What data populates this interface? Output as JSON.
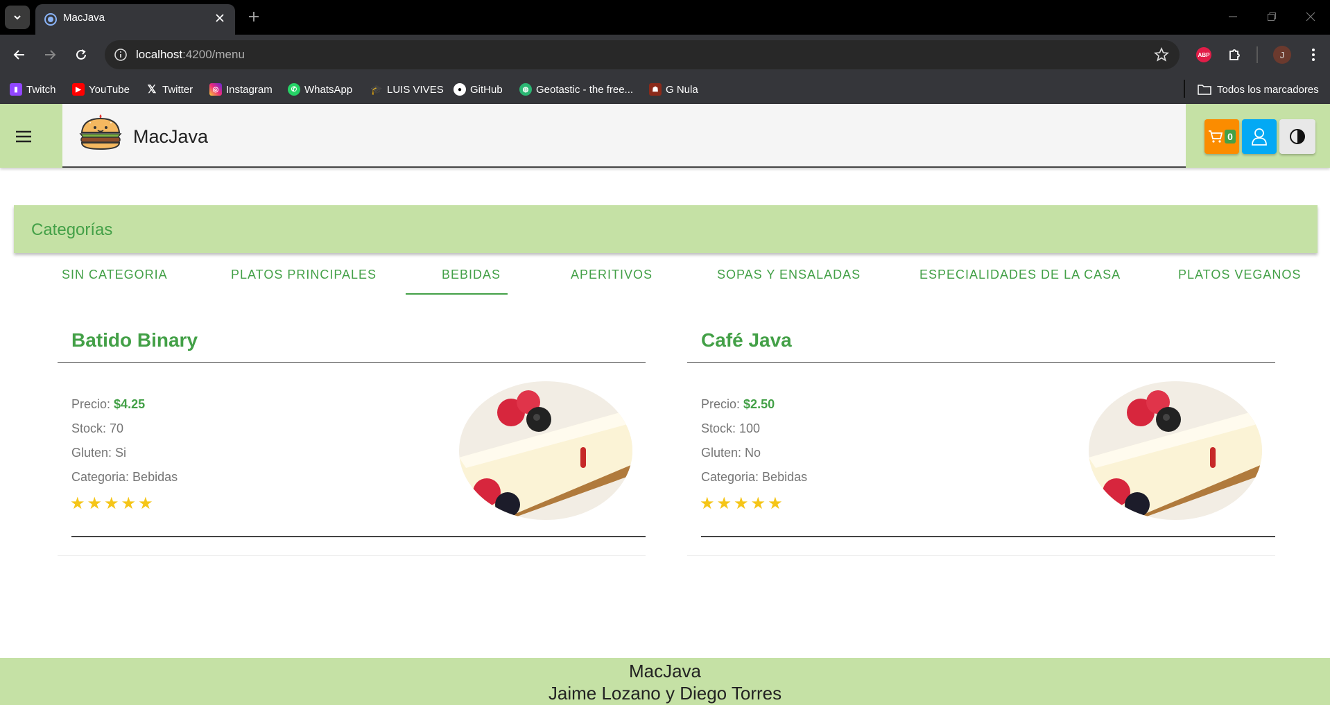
{
  "browser": {
    "tab_title": "MacJava",
    "url_host": "localhost",
    "url_path": ":4200/menu",
    "profile_initial": "J",
    "extension_abp": "ABP",
    "bookmarks": [
      {
        "label": "Twitch",
        "icon": "twitch-icon",
        "color": "#9146ff"
      },
      {
        "label": "YouTube",
        "icon": "youtube-icon",
        "color": "#ff0000"
      },
      {
        "label": "Twitter",
        "icon": "x-twitter-icon",
        "color": "#000000"
      },
      {
        "label": "Instagram",
        "icon": "instagram-icon",
        "color": "#e1306c"
      },
      {
        "label": "WhatsApp",
        "icon": "whatsapp-icon",
        "color": "#25d366"
      },
      {
        "label": "LUIS VIVES",
        "icon": "graduation-cap-icon",
        "color": "#1e6fd9"
      },
      {
        "label": "GitHub",
        "icon": "github-icon",
        "color": "#ffffff"
      },
      {
        "label": "Geotastic - the free...",
        "icon": "globe-icon",
        "color": "#2bb673"
      },
      {
        "label": "G Nula",
        "icon": "game-avatar-icon",
        "color": "#8b2a1a"
      }
    ],
    "all_bookmarks": "Todos los marcadores"
  },
  "header": {
    "brand": "MacJava",
    "cart_count": "0"
  },
  "categories": {
    "title": "Categorías",
    "tabs": [
      "SIN CATEGORIA",
      "PLATOS PRINCIPALES",
      "BEBIDAS",
      "APERITIVOS",
      "SOPAS Y ENSALADAS",
      "ESPECIALIDADES DE LA CASA",
      "PLATOS VEGANOS"
    ],
    "active": "BEBIDAS"
  },
  "products": [
    {
      "name": "Batido Binary",
      "price_label": "Precio:",
      "price": "$4.25",
      "stock": "Stock: 70",
      "gluten": "Gluten: Si",
      "category": "Categoria: Bebidas",
      "stars": "★★★★★",
      "rating": 5
    },
    {
      "name": "Café Java",
      "price_label": "Precio:",
      "price": "$2.50",
      "stock": "Stock: 100",
      "gluten": "Gluten: No",
      "category": "Categoria: Bebidas",
      "stars": "★★★★★",
      "rating": 5
    }
  ],
  "footer": {
    "line1": "MacJava",
    "line2": "Jaime Lozano y Diego Torres"
  },
  "colors": {
    "accent_green": "#43a047",
    "header_green": "#c5e1a5",
    "cart_orange": "#fb8c00",
    "user_blue": "#03a9f4",
    "star_gold": "#f5c518"
  }
}
